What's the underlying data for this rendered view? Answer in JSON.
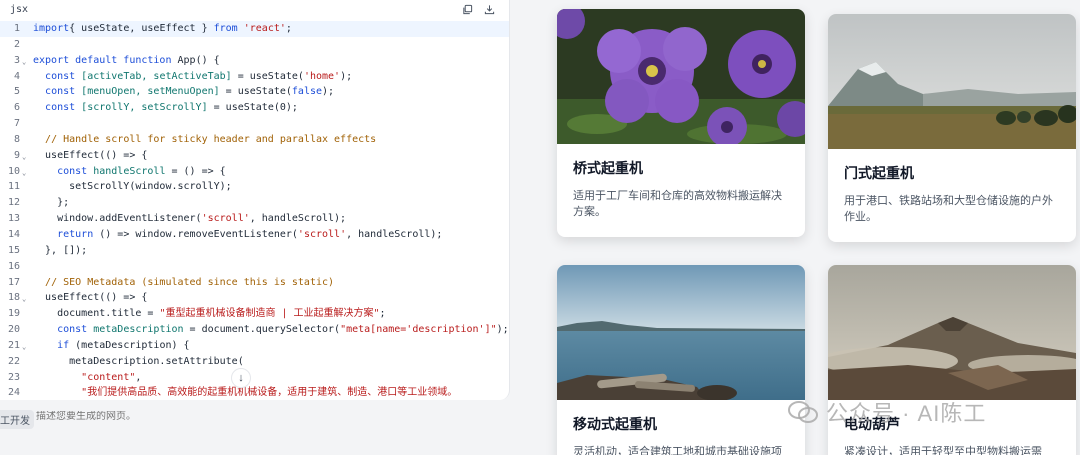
{
  "editor": {
    "language": "jsx",
    "tools": [
      "copy-icon",
      "download-icon"
    ],
    "lines": [
      {
        "n": "1",
        "fold": false,
        "active": true,
        "segs": [
          [
            "kw",
            "import"
          ],
          [
            "",
            "{ "
          ],
          [
            "fn",
            "useState, useEffect"
          ],
          [
            "",
            " } "
          ],
          [
            "kw",
            "from"
          ],
          [
            "str",
            " 'react'"
          ],
          [
            "",
            ";"
          ]
        ]
      },
      {
        "n": "2",
        "fold": false,
        "segs": []
      },
      {
        "n": "3",
        "fold": true,
        "segs": [
          [
            "kw",
            "export default function "
          ],
          [
            "fn",
            "App"
          ],
          [
            "",
            "() {"
          ]
        ]
      },
      {
        "n": "4",
        "fold": false,
        "segs": [
          [
            "",
            "  "
          ],
          [
            "kw",
            "const "
          ],
          [
            "pm",
            "[activeTab, setActiveTab]"
          ],
          [
            "",
            " = useState("
          ],
          [
            "str",
            "'home'"
          ],
          [
            "",
            ");"
          ]
        ]
      },
      {
        "n": "5",
        "fold": false,
        "segs": [
          [
            "",
            "  "
          ],
          [
            "kw",
            "const "
          ],
          [
            "pm",
            "[menuOpen, setMenuOpen]"
          ],
          [
            "",
            " = useState("
          ],
          [
            "kw",
            "false"
          ],
          [
            "",
            ");"
          ]
        ]
      },
      {
        "n": "6",
        "fold": false,
        "segs": [
          [
            "",
            "  "
          ],
          [
            "kw",
            "const "
          ],
          [
            "pm",
            "[scrollY, setScrollY]"
          ],
          [
            "",
            " = useState(0);"
          ]
        ]
      },
      {
        "n": "7",
        "fold": false,
        "segs": []
      },
      {
        "n": "8",
        "fold": false,
        "segs": [
          [
            "",
            "  "
          ],
          [
            "cm",
            "// Handle scroll for sticky header and parallax effects"
          ]
        ]
      },
      {
        "n": "9",
        "fold": true,
        "segs": [
          [
            "",
            "  useEffect(() => {"
          ]
        ]
      },
      {
        "n": "10",
        "fold": true,
        "segs": [
          [
            "",
            "    "
          ],
          [
            "kw",
            "const "
          ],
          [
            "pm",
            "handleScroll"
          ],
          [
            "",
            " = () => {"
          ]
        ]
      },
      {
        "n": "11",
        "fold": false,
        "segs": [
          [
            "",
            "      setScrollY(window.scrollY);"
          ]
        ]
      },
      {
        "n": "12",
        "fold": false,
        "segs": [
          [
            "",
            "    };"
          ]
        ]
      },
      {
        "n": "13",
        "fold": false,
        "segs": [
          [
            "",
            "    window.addEventListener("
          ],
          [
            "str",
            "'scroll'"
          ],
          [
            "",
            ", handleScroll);"
          ]
        ]
      },
      {
        "n": "14",
        "fold": false,
        "segs": [
          [
            "",
            "    "
          ],
          [
            "kw",
            "return"
          ],
          [
            "",
            " () => window.removeEventListener("
          ],
          [
            "str",
            "'scroll'"
          ],
          [
            "",
            ", handleScroll);"
          ]
        ]
      },
      {
        "n": "15",
        "fold": false,
        "segs": [
          [
            "",
            "  }, []);"
          ]
        ]
      },
      {
        "n": "16",
        "fold": false,
        "segs": []
      },
      {
        "n": "17",
        "fold": false,
        "segs": [
          [
            "",
            "  "
          ],
          [
            "cm",
            "// SEO Metadata (simulated since this is static)"
          ]
        ]
      },
      {
        "n": "18",
        "fold": true,
        "segs": [
          [
            "",
            "  useEffect(() => {"
          ]
        ]
      },
      {
        "n": "19",
        "fold": false,
        "segs": [
          [
            "",
            "    document.title = "
          ],
          [
            "str",
            "\"重型起重机械设备制造商 | 工业起重解决方案\""
          ],
          [
            "",
            ";"
          ]
        ]
      },
      {
        "n": "20",
        "fold": false,
        "segs": [
          [
            "",
            "    "
          ],
          [
            "kw",
            "const "
          ],
          [
            "pm",
            "metaDescription"
          ],
          [
            "",
            " = document.querySelector("
          ],
          [
            "str",
            "\"meta[name='description']\""
          ],
          [
            "",
            ");"
          ]
        ]
      },
      {
        "n": "21",
        "fold": true,
        "segs": [
          [
            "",
            "    "
          ],
          [
            "kw",
            "if"
          ],
          [
            "",
            " (metaDescription) {"
          ]
        ]
      },
      {
        "n": "22",
        "fold": false,
        "segs": [
          [
            "",
            "      metaDescription.setAttribute("
          ]
        ]
      },
      {
        "n": "23",
        "fold": false,
        "segs": [
          [
            "",
            "        "
          ],
          [
            "str",
            "\"content\""
          ],
          [
            "",
            ","
          ]
        ]
      },
      {
        "n": "24",
        "fold": false,
        "segs": [
          [
            "",
            "        "
          ],
          [
            "str",
            "\"我们提供高品质、高效能的起重机机械设备，适用于建筑、制造、港口等工业领域。"
          ]
        ]
      }
    ]
  },
  "prompt": {
    "chip": "工开发",
    "placeholder": "描述您要生成的网页。"
  },
  "cards": [
    {
      "title": "桥式起重机",
      "desc": "适用于工厂车间和仓库的高效物料搬运解决方案。",
      "image": "purple-petunia-flowers"
    },
    {
      "title": "门式起重机",
      "desc": "用于港口、铁路站场和大型仓储设施的户外作业。",
      "image": "mountain-valley-landscape"
    },
    {
      "title": "移动式起重机",
      "desc": "灵活机动，适合建筑工地和城市基础设施项",
      "image": "coastal-lake-driftwood"
    },
    {
      "title": "电动葫芦",
      "desc": "紧凑设计，适用于轻型至中型物料搬运需",
      "image": "volcano-landscape"
    }
  ],
  "watermark": "公众号 · AI陈工"
}
